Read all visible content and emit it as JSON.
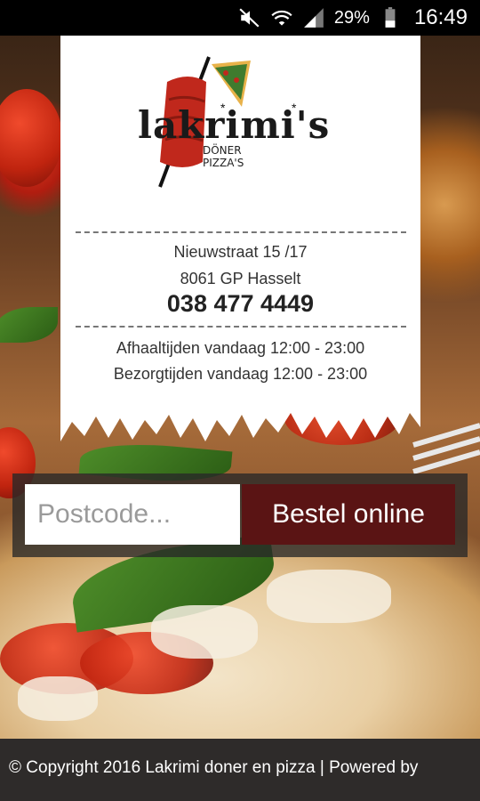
{
  "status_bar": {
    "battery_percent": "29%",
    "time": "16:49"
  },
  "restaurant": {
    "logo_name": "lakrimi's",
    "logo_sub_1": "DÖNER",
    "logo_sub_2": "PIZZA'S"
  },
  "contact": {
    "street": "Nieuwstraat 15 /17",
    "city": "8061 GP Hasselt",
    "phone": "038 477 4449"
  },
  "hours": {
    "pickup": "Afhaaltijden vandaag 12:00 - 23:00",
    "delivery": "Bezorgtijden vandaag 12:00 - 23:00"
  },
  "order": {
    "postcode_placeholder": "Postcode...",
    "postcode_value": "",
    "button_label": "Bestel online"
  },
  "footer": {
    "text": "© Copyright 2016 Lakrimi doner en pizza | Powered by"
  },
  "colors": {
    "button_bg": "#5a1414",
    "status_bar_bg": "#000000",
    "footer_bg": "#2e2b2a"
  }
}
